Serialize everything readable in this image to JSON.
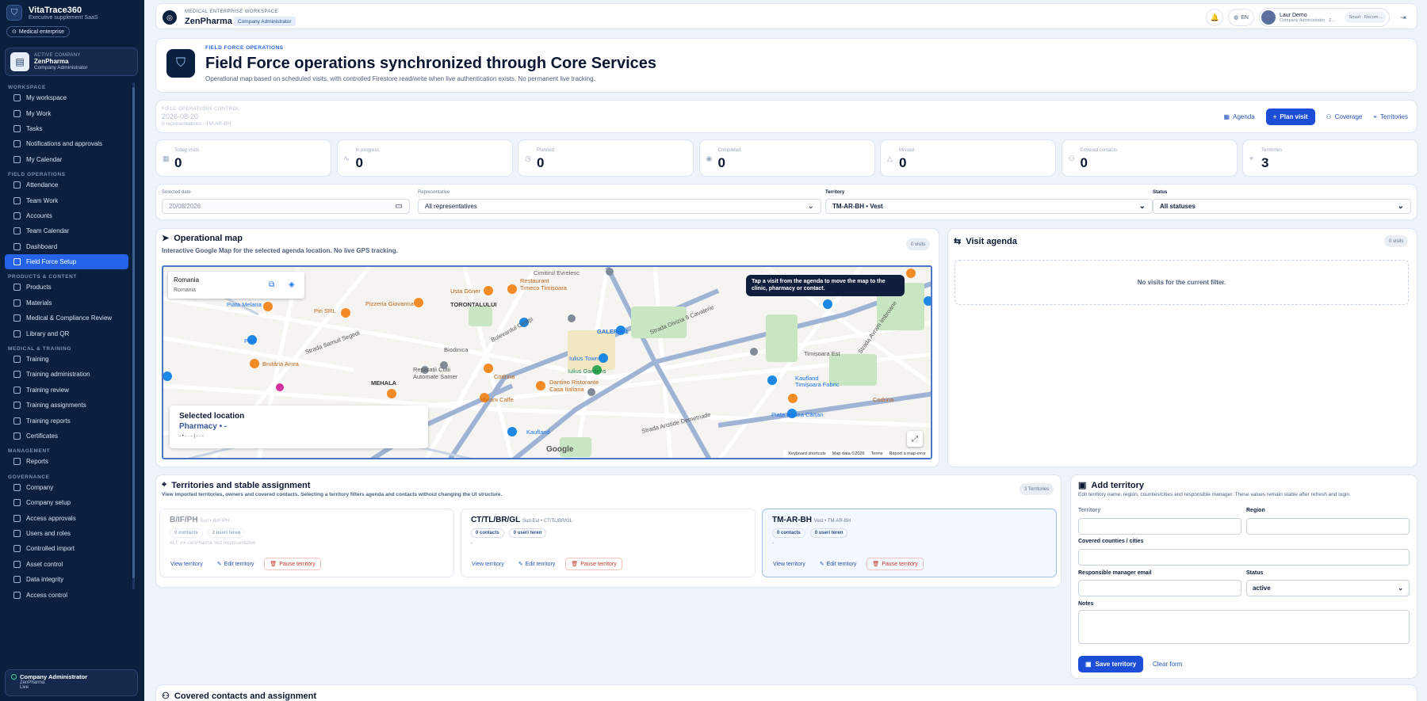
{
  "sidebar": {
    "app_name": "VitaTrace360",
    "app_tagline": "Executive supplement SaaS",
    "env_badge": "Medical enterprise",
    "company_box": {
      "label": "ACTIVE COMPANY",
      "name": "ZenPharma",
      "role": "Company Administrator"
    },
    "sections": [
      {
        "title": "WORKSPACE",
        "items": [
          "My workspace",
          "My Work",
          "Tasks",
          "Notifications and approvals",
          "My Calendar"
        ]
      },
      {
        "title": "FIELD OPERATIONS",
        "items": [
          "Attendance",
          "Team Work",
          "Accounts",
          "Team Calendar",
          "Dashboard",
          "Field Force Setup"
        ]
      },
      {
        "title": "PRODUCTS & CONTENT",
        "items": [
          "Products",
          "Materials",
          "Medical & Compliance Review",
          "Library and QR"
        ]
      },
      {
        "title": "MEDICAL & TRAINING",
        "items": [
          "Training",
          "Training administration",
          "Training review",
          "Training assignments",
          "Training reports",
          "Certificates"
        ]
      },
      {
        "title": "MANAGEMENT",
        "items": [
          "Reports"
        ]
      },
      {
        "title": "GOVERNANCE",
        "items": [
          "Company",
          "Company setup",
          "Access approvals",
          "Users and roles",
          "Controlled import",
          "Asset control",
          "Data integrity",
          "Access control"
        ]
      }
    ],
    "active_item": "Field Force Setup",
    "footer": {
      "title": "Company Administrator",
      "company": "ZenPharma",
      "status": "Live"
    }
  },
  "topbar": {
    "workspace_label": "MEDICAL ENTERPRISE WORKSPACE",
    "workspace_name": "ZenPharma",
    "role_badge": "Company Administrator",
    "lang": "EN",
    "user_name": "Laur Demo",
    "user_role": "Company Administrator · Z...",
    "user_chip": "Smart · Recom..."
  },
  "hero": {
    "kicker": "FIELD FORCE OPERATIONS",
    "title": "Field Force operations synchronized through Core Services",
    "subtitle": "Operational map based on scheduled visits, with controlled Firestore read/write when live authentication exists. No permanent live tracking."
  },
  "control": {
    "label": "FIELD OPERATIONS CONTROL",
    "date": "2026-08-20",
    "meta": "0 representatives · TM-AR-BH",
    "actions": {
      "agenda": "Agenda",
      "plan": "Plan visit",
      "coverage": "Coverage",
      "territories": "Territories"
    }
  },
  "kpis": [
    {
      "label": "Today visits",
      "value": "0",
      "icon": "calendar-icon"
    },
    {
      "label": "In progress",
      "value": "0",
      "icon": "activity-icon"
    },
    {
      "label": "Planned",
      "value": "0",
      "icon": "clock-icon"
    },
    {
      "label": "Completed",
      "value": "0",
      "icon": "check-circle-icon"
    },
    {
      "label": "Missed",
      "value": "0",
      "icon": "alert-icon"
    },
    {
      "label": "Covered contacts",
      "value": "0",
      "icon": "users-icon"
    },
    {
      "label": "Territories",
      "value": "3",
      "icon": "pin-icon"
    }
  ],
  "filters": {
    "date_label": "Selected date",
    "date_value": "20/08/2026",
    "rep_label": "Representative",
    "rep_value": "All representatives",
    "terr_label": "Territory",
    "terr_value": "TM-AR-BH • Vest",
    "status_label": "Status",
    "status_value": "All statuses"
  },
  "map": {
    "title": "Operational map",
    "subtitle": "Interactive Google Map for the selected agenda location. No live GPS tracking.",
    "count": "0 visits",
    "place_title": "Romania",
    "place_sub": "Romania",
    "tip": "Tap a visit from the agenda to move the map to the clinic, pharmacy or contact.",
    "selected_title": "Selected location",
    "selected_name": "Pharmacy • -",
    "selected_meta": "- • - · - | - · -",
    "google": "Google",
    "footer": [
      "Keyboard shortcuts",
      "Map data ©2026",
      "Terms",
      "Report a map error"
    ],
    "labels": [
      "Cimitirul Evreiesc",
      "Usta Döner",
      "Restaurant Timeco Timișoara",
      "TORONTALULUI",
      "Pizzeria Giovanna",
      "Piri SRL",
      "Piata Melana",
      "Profi",
      "Biodinica",
      "Brutăria Amra",
      "MEHALA",
      "Reparații Cutii Automate Samer",
      "Codrina",
      "Dantino Ristorante Casa Italiana",
      "Viviani Caffe",
      "Iulius Town",
      "Iulius Gardens",
      "GALERIA 1",
      "Strada Divizia 9 Cavalerie",
      "Timișoara Est",
      "Kaufland Timișoara Fabric",
      "Piața Badea Cârțan",
      "Kaufland",
      "Codrina",
      "Strada Aristide Demetriade",
      "Bulevardul Cetății",
      "Strada Samuil Segedi",
      "Strada Avram Imbroane"
    ]
  },
  "agenda": {
    "title": "Visit agenda",
    "count": "0 visits",
    "empty": "No visits for the current filter."
  },
  "territories": {
    "title": "Territories and stable assignment",
    "subtitle": "View imported territories, owners and covered contacts. Selecting a territory filters agenda and contacts without changing the UI structure.",
    "count": "3 Territories",
    "items": [
      {
        "code": "B/IF/PH",
        "region": "Sud • B/IF/PH",
        "contacts": "0 contacts",
        "users": "2 useri teren",
        "owner": "ALT: P4 ZenPharma Test Representative"
      },
      {
        "code": "CT/TL/BR/GL",
        "region": "Sud-Est • CT/TL/BR/GL",
        "contacts": "0 contacts",
        "users": "0 useri teren",
        "owner": "-"
      },
      {
        "code": "TM-AR-BH",
        "region": "Vest • TM-AR-BH",
        "contacts": "0 contacts",
        "users": "0 useri teren",
        "owner": "-"
      }
    ],
    "actions": {
      "view": "View territory",
      "edit": "Edit territory",
      "pause": "Pause territory"
    }
  },
  "add_territory": {
    "title": "Add territory",
    "subtitle": "Edit territory name, region, counties/cities and responsible manager. These values remain stable after refresh and login.",
    "territory_label": "Territory",
    "region_label": "Region",
    "counties_label": "Covered counties / cities",
    "manager_label": "Responsible manager email",
    "status_label": "Status",
    "status_value": "active",
    "notes_label": "Notes",
    "save": "Save territory",
    "clear": "Clear form"
  },
  "contacts_section": {
    "title": "Covered contacts and assignment"
  }
}
